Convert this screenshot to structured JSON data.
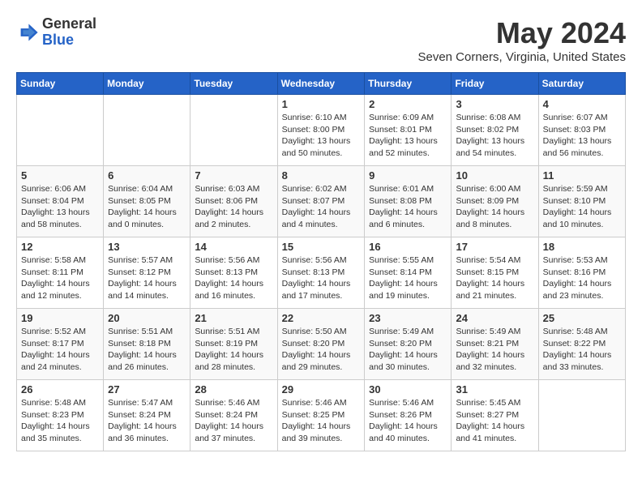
{
  "header": {
    "logo_line1": "General",
    "logo_line2": "Blue",
    "month": "May 2024",
    "location": "Seven Corners, Virginia, United States"
  },
  "days_of_week": [
    "Sunday",
    "Monday",
    "Tuesday",
    "Wednesday",
    "Thursday",
    "Friday",
    "Saturday"
  ],
  "weeks": [
    [
      {
        "day": "",
        "info": ""
      },
      {
        "day": "",
        "info": ""
      },
      {
        "day": "",
        "info": ""
      },
      {
        "day": "1",
        "info": "Sunrise: 6:10 AM\nSunset: 8:00 PM\nDaylight: 13 hours\nand 50 minutes."
      },
      {
        "day": "2",
        "info": "Sunrise: 6:09 AM\nSunset: 8:01 PM\nDaylight: 13 hours\nand 52 minutes."
      },
      {
        "day": "3",
        "info": "Sunrise: 6:08 AM\nSunset: 8:02 PM\nDaylight: 13 hours\nand 54 minutes."
      },
      {
        "day": "4",
        "info": "Sunrise: 6:07 AM\nSunset: 8:03 PM\nDaylight: 13 hours\nand 56 minutes."
      }
    ],
    [
      {
        "day": "5",
        "info": "Sunrise: 6:06 AM\nSunset: 8:04 PM\nDaylight: 13 hours\nand 58 minutes."
      },
      {
        "day": "6",
        "info": "Sunrise: 6:04 AM\nSunset: 8:05 PM\nDaylight: 14 hours\nand 0 minutes."
      },
      {
        "day": "7",
        "info": "Sunrise: 6:03 AM\nSunset: 8:06 PM\nDaylight: 14 hours\nand 2 minutes."
      },
      {
        "day": "8",
        "info": "Sunrise: 6:02 AM\nSunset: 8:07 PM\nDaylight: 14 hours\nand 4 minutes."
      },
      {
        "day": "9",
        "info": "Sunrise: 6:01 AM\nSunset: 8:08 PM\nDaylight: 14 hours\nand 6 minutes."
      },
      {
        "day": "10",
        "info": "Sunrise: 6:00 AM\nSunset: 8:09 PM\nDaylight: 14 hours\nand 8 minutes."
      },
      {
        "day": "11",
        "info": "Sunrise: 5:59 AM\nSunset: 8:10 PM\nDaylight: 14 hours\nand 10 minutes."
      }
    ],
    [
      {
        "day": "12",
        "info": "Sunrise: 5:58 AM\nSunset: 8:11 PM\nDaylight: 14 hours\nand 12 minutes."
      },
      {
        "day": "13",
        "info": "Sunrise: 5:57 AM\nSunset: 8:12 PM\nDaylight: 14 hours\nand 14 minutes."
      },
      {
        "day": "14",
        "info": "Sunrise: 5:56 AM\nSunset: 8:13 PM\nDaylight: 14 hours\nand 16 minutes."
      },
      {
        "day": "15",
        "info": "Sunrise: 5:56 AM\nSunset: 8:13 PM\nDaylight: 14 hours\nand 17 minutes."
      },
      {
        "day": "16",
        "info": "Sunrise: 5:55 AM\nSunset: 8:14 PM\nDaylight: 14 hours\nand 19 minutes."
      },
      {
        "day": "17",
        "info": "Sunrise: 5:54 AM\nSunset: 8:15 PM\nDaylight: 14 hours\nand 21 minutes."
      },
      {
        "day": "18",
        "info": "Sunrise: 5:53 AM\nSunset: 8:16 PM\nDaylight: 14 hours\nand 23 minutes."
      }
    ],
    [
      {
        "day": "19",
        "info": "Sunrise: 5:52 AM\nSunset: 8:17 PM\nDaylight: 14 hours\nand 24 minutes."
      },
      {
        "day": "20",
        "info": "Sunrise: 5:51 AM\nSunset: 8:18 PM\nDaylight: 14 hours\nand 26 minutes."
      },
      {
        "day": "21",
        "info": "Sunrise: 5:51 AM\nSunset: 8:19 PM\nDaylight: 14 hours\nand 28 minutes."
      },
      {
        "day": "22",
        "info": "Sunrise: 5:50 AM\nSunset: 8:20 PM\nDaylight: 14 hours\nand 29 minutes."
      },
      {
        "day": "23",
        "info": "Sunrise: 5:49 AM\nSunset: 8:20 PM\nDaylight: 14 hours\nand 30 minutes."
      },
      {
        "day": "24",
        "info": "Sunrise: 5:49 AM\nSunset: 8:21 PM\nDaylight: 14 hours\nand 32 minutes."
      },
      {
        "day": "25",
        "info": "Sunrise: 5:48 AM\nSunset: 8:22 PM\nDaylight: 14 hours\nand 33 minutes."
      }
    ],
    [
      {
        "day": "26",
        "info": "Sunrise: 5:48 AM\nSunset: 8:23 PM\nDaylight: 14 hours\nand 35 minutes."
      },
      {
        "day": "27",
        "info": "Sunrise: 5:47 AM\nSunset: 8:24 PM\nDaylight: 14 hours\nand 36 minutes."
      },
      {
        "day": "28",
        "info": "Sunrise: 5:46 AM\nSunset: 8:24 PM\nDaylight: 14 hours\nand 37 minutes."
      },
      {
        "day": "29",
        "info": "Sunrise: 5:46 AM\nSunset: 8:25 PM\nDaylight: 14 hours\nand 39 minutes."
      },
      {
        "day": "30",
        "info": "Sunrise: 5:46 AM\nSunset: 8:26 PM\nDaylight: 14 hours\nand 40 minutes."
      },
      {
        "day": "31",
        "info": "Sunrise: 5:45 AM\nSunset: 8:27 PM\nDaylight: 14 hours\nand 41 minutes."
      },
      {
        "day": "",
        "info": ""
      }
    ]
  ]
}
